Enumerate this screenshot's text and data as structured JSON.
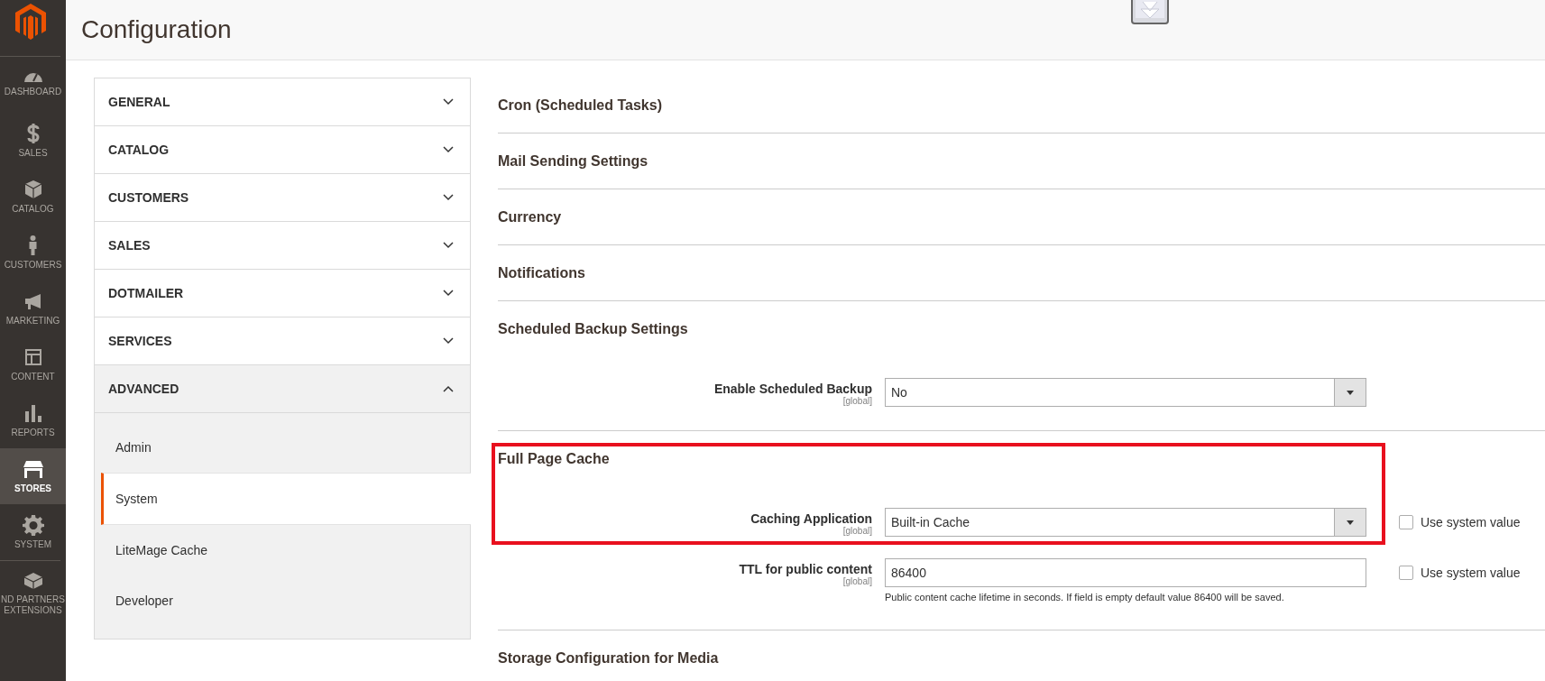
{
  "nav": {
    "items": [
      {
        "kind": "dashboard",
        "label": [
          "DASHBOARD"
        ],
        "selected": false
      },
      {
        "kind": "sales",
        "label": [
          "SALES"
        ],
        "selected": false
      },
      {
        "kind": "catalog",
        "label": [
          "CATALOG"
        ],
        "selected": false
      },
      {
        "kind": "customers",
        "label": [
          "CUSTOMERS"
        ],
        "selected": false
      },
      {
        "kind": "marketing",
        "label": [
          "MARKETING"
        ],
        "selected": false
      },
      {
        "kind": "content",
        "label": [
          "CONTENT"
        ],
        "selected": false
      },
      {
        "kind": "reports",
        "label": [
          "REPORTS"
        ],
        "selected": false
      },
      {
        "kind": "stores",
        "label": [
          "STORES"
        ],
        "selected": true
      },
      {
        "kind": "system",
        "label": [
          "SYSTEM"
        ],
        "selected": false
      },
      {
        "kind": "extensions",
        "label": [
          "ND PARTNERS",
          "EXTENSIONS"
        ],
        "selected": false
      }
    ]
  },
  "header": {
    "title": "Configuration"
  },
  "config_tabs": [
    {
      "title": "GENERAL",
      "expanded": false
    },
    {
      "title": "CATALOG",
      "expanded": false
    },
    {
      "title": "CUSTOMERS",
      "expanded": false
    },
    {
      "title": "SALES",
      "expanded": false
    },
    {
      "title": "DOTMAILER",
      "expanded": false
    },
    {
      "title": "SERVICES",
      "expanded": false
    },
    {
      "title": "ADVANCED",
      "expanded": true,
      "children": [
        {
          "label": "Admin",
          "selected": false
        },
        {
          "label": "System",
          "selected": true
        },
        {
          "label": "LiteMage Cache",
          "selected": false
        },
        {
          "label": "Developer",
          "selected": false
        }
      ]
    }
  ],
  "sections": [
    {
      "title": "Cron (Scheduled Tasks)",
      "highlighted": false
    },
    {
      "title": "Mail Sending Settings",
      "highlighted": false
    },
    {
      "title": "Currency",
      "highlighted": false
    },
    {
      "title": "Notifications",
      "highlighted": false
    },
    {
      "title": "Scheduled Backup Settings",
      "highlighted": false,
      "fields": [
        {
          "label": "Enable Scheduled Backup",
          "scope": "[global]",
          "kind": "select",
          "value": "No"
        }
      ]
    },
    {
      "title": "Full Page Cache",
      "highlighted": true,
      "fields": [
        {
          "label": "Caching Application",
          "scope": "[global]",
          "kind": "select",
          "value": "Built-in Cache",
          "use_system_value": {
            "label": "Use system value",
            "checked": false
          }
        },
        {
          "label": "TTL for public content",
          "scope": "[global]",
          "kind": "text",
          "value": "86400",
          "note": "Public content cache lifetime in seconds. If field is empty default value 86400 will be saved.",
          "use_system_value": {
            "label": "Use system value",
            "checked": false
          }
        }
      ]
    },
    {
      "title": "Storage Configuration for Media",
      "highlighted": false
    }
  ]
}
